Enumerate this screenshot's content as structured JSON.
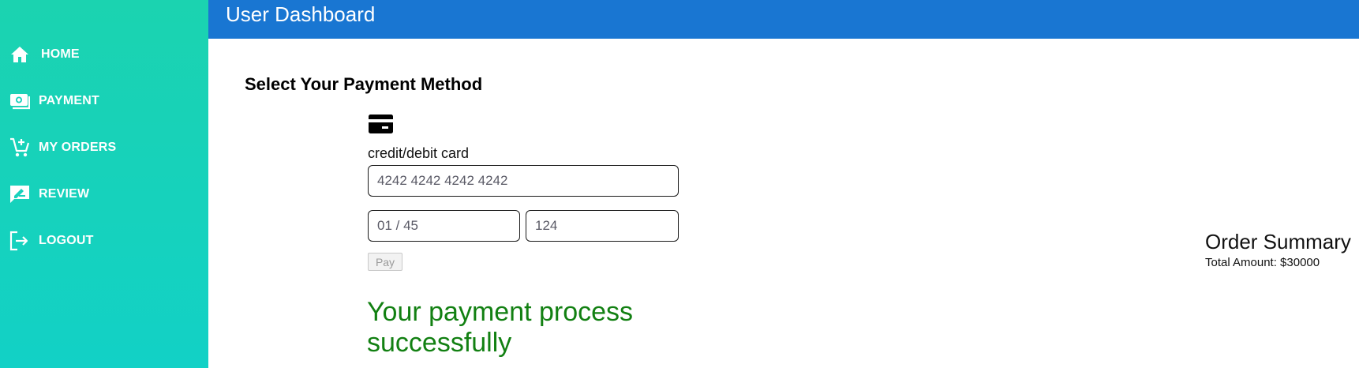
{
  "header": {
    "title": "User Dashboard"
  },
  "sidebar": {
    "items": [
      {
        "label": "HOME",
        "icon": "home-icon"
      },
      {
        "label": "PAYMENT",
        "icon": "payment-icon"
      },
      {
        "label": "MY ORDERS",
        "icon": "cart-icon"
      },
      {
        "label": "REVIEW",
        "icon": "review-icon"
      },
      {
        "label": "LOGOUT",
        "icon": "logout-icon"
      }
    ]
  },
  "payment": {
    "heading": "Select Your Payment Method",
    "method_icon": "credit-card-icon",
    "method_label": "credit/debit card",
    "card_number": "4242 4242 4242 4242",
    "expiry": "01 / 45",
    "cvc": "124",
    "pay_label": "Pay",
    "success_message": "Your payment process successfully"
  },
  "summary": {
    "title": "Order Summary",
    "total": "Total Amount: $30000"
  },
  "colors": {
    "sidebar_gradient_top": "#1bd3b0",
    "sidebar_gradient_bottom": "#12d1c6",
    "header": "#1976d2",
    "success": "#128012"
  }
}
